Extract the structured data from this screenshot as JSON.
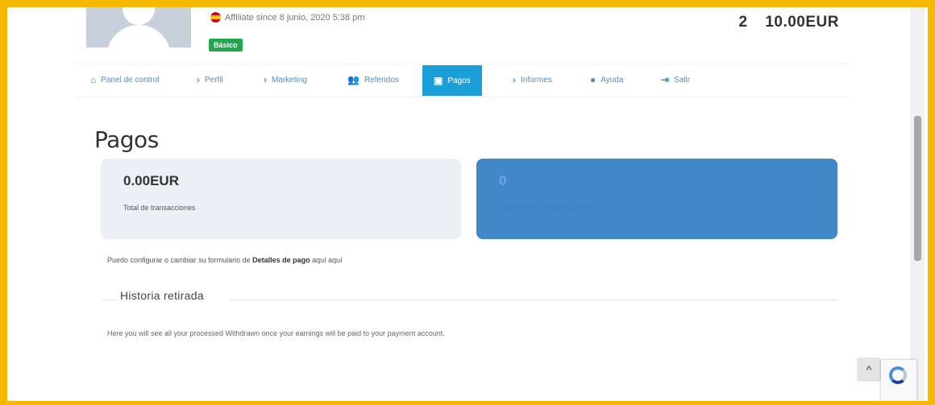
{
  "header": {
    "affiliate_since": "Affiliate since 8 junio, 2020 5:38 pm",
    "badge": "Básico",
    "stat_count": "2",
    "stat_amount": "10.00EUR"
  },
  "nav": {
    "items": [
      {
        "label": "Panel de control",
        "icon": "home-icon"
      },
      {
        "label": "Perfil",
        "icon": "chevron-right-icon"
      },
      {
        "label": "Marketing",
        "icon": "chevron-right-icon"
      },
      {
        "label": "Referidos",
        "icon": "users-icon"
      },
      {
        "label": "Pagos",
        "icon": "money-icon"
      },
      {
        "label": "Informes",
        "icon": "chevron-right-icon"
      },
      {
        "label": "Ayuda",
        "icon": "question-icon"
      },
      {
        "label": "Salir",
        "icon": "logout-icon"
      }
    ],
    "active": "Pagos"
  },
  "page": {
    "title": "Pagos",
    "card_left": {
      "amount": "0.00EUR",
      "label": "Total de transacciones"
    },
    "card_right": {
      "amount": "0",
      "label": "Número total de transacciones"
    },
    "info_prefix": "Puedo configurar o cambiar su formulario de ",
    "info_bold": "Detalles de pago",
    "info_link": " aquí aquí",
    "section_title": "Historia retirada",
    "note": "Here you will see all your processed Withdrawn once your earnings will be paid to your payment account."
  },
  "colors": {
    "accent": "#1a9fd9",
    "frame": "#f7b800",
    "card_right": "#4188c9",
    "badge": "#21a84a"
  }
}
